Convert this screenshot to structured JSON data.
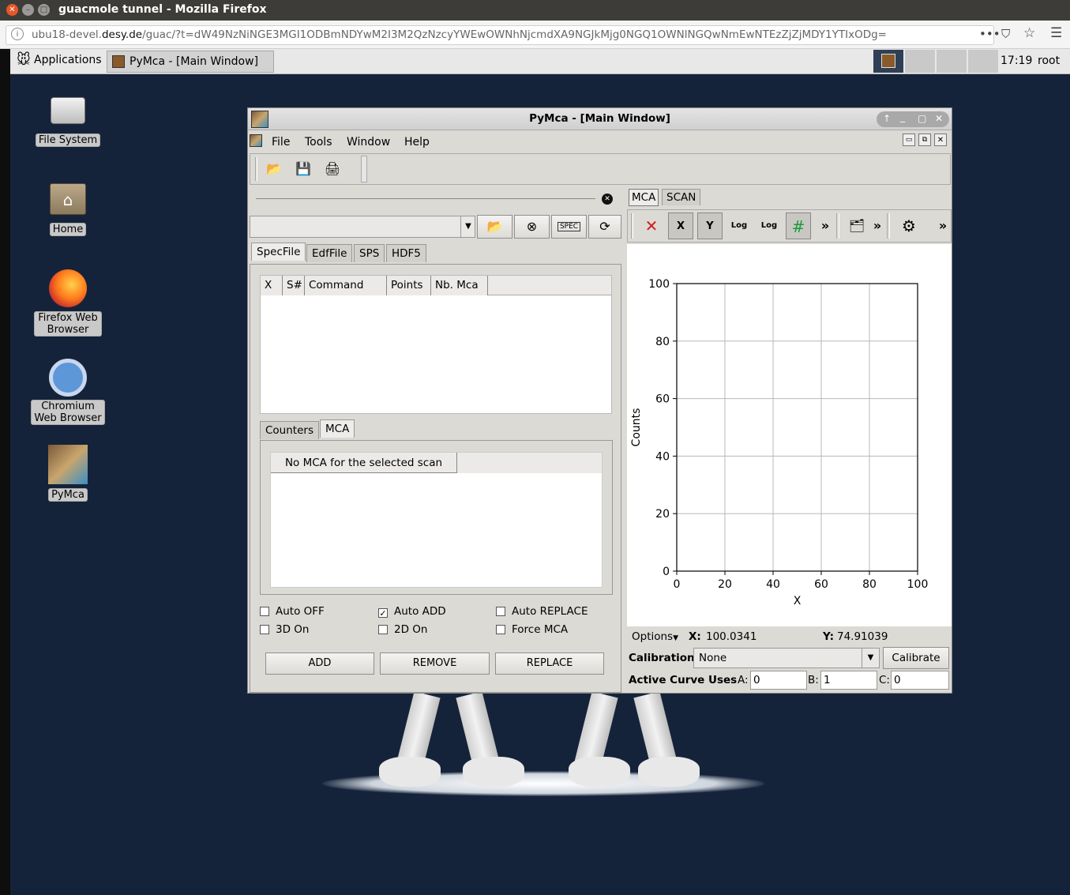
{
  "firefox": {
    "window_title": "guacmole tunnel - Mozilla Firefox",
    "url_prefix": "ubu18-devel.",
    "url_domain": "desy.de",
    "url_rest": "/guac/?t=dW49NzNiNGE3MGI1ODBmNDYwM2I3M2QzNzcyYWEwOWNhNjcmdXA9NGJkMjg0NGQ1OWNlNGQwNmEwNTEzZjZjMDY1YTIxODg=",
    "page_actions": "•••"
  },
  "taskbar": {
    "applications_label": "Applications",
    "task_label": "PyMca - [Main Window]",
    "time": "17:19",
    "user": "root"
  },
  "desktop_icons": [
    {
      "label": "File System"
    },
    {
      "label": "Home"
    },
    {
      "label": "Firefox Web Browser"
    },
    {
      "label": "Chromium Web Browser"
    },
    {
      "label": "PyMca"
    }
  ],
  "pymca": {
    "title": "PyMca - [Main Window]",
    "menu": [
      "File",
      "Tools",
      "Window",
      "Help"
    ],
    "source_tabs": [
      "SpecFile",
      "EdfFile",
      "SPS",
      "HDF5"
    ],
    "scan_columns": [
      "X",
      "S#",
      "Command",
      "Points",
      "Nb. Mca"
    ],
    "sub_tabs": [
      "Counters",
      "MCA"
    ],
    "mca_message": "No MCA for the selected scan",
    "checkboxes": [
      {
        "label": "Auto OFF",
        "checked": false
      },
      {
        "label": "Auto ADD",
        "checked": true
      },
      {
        "label": "Auto REPLACE",
        "checked": false
      },
      {
        "label": "3D On",
        "checked": false
      },
      {
        "label": "2D On",
        "checked": false
      },
      {
        "label": "Force MCA",
        "checked": false
      }
    ],
    "buttons": {
      "add": "ADD",
      "remove": "REMOVE",
      "replace": "REPLACE"
    },
    "plot_tabs": [
      "MCA",
      "SCAN"
    ],
    "toolbar_log": "Log",
    "toolbar_x": "X",
    "toolbar_y": "Y",
    "more": "»",
    "status": {
      "options": "Options",
      "x_label": "X:",
      "x_value": "100.0341",
      "y_label": "Y:",
      "y_value": "74.91039"
    },
    "calibration": {
      "label": "Calibration",
      "value": "None",
      "button": "Calibrate"
    },
    "active_curve": {
      "label": "Active Curve Uses",
      "a_label": "A:",
      "a_value": "0",
      "b_label": "B:",
      "b_value": "1",
      "c_label": "C:",
      "c_value": "0"
    }
  },
  "chart_data": {
    "type": "line",
    "title": "",
    "xlabel": "X",
    "ylabel": "Counts",
    "xlim": [
      0,
      100
    ],
    "ylim": [
      0,
      100
    ],
    "xticks": [
      0,
      20,
      40,
      60,
      80,
      100
    ],
    "yticks": [
      0,
      20,
      40,
      60,
      80,
      100
    ],
    "grid": true,
    "series": []
  }
}
